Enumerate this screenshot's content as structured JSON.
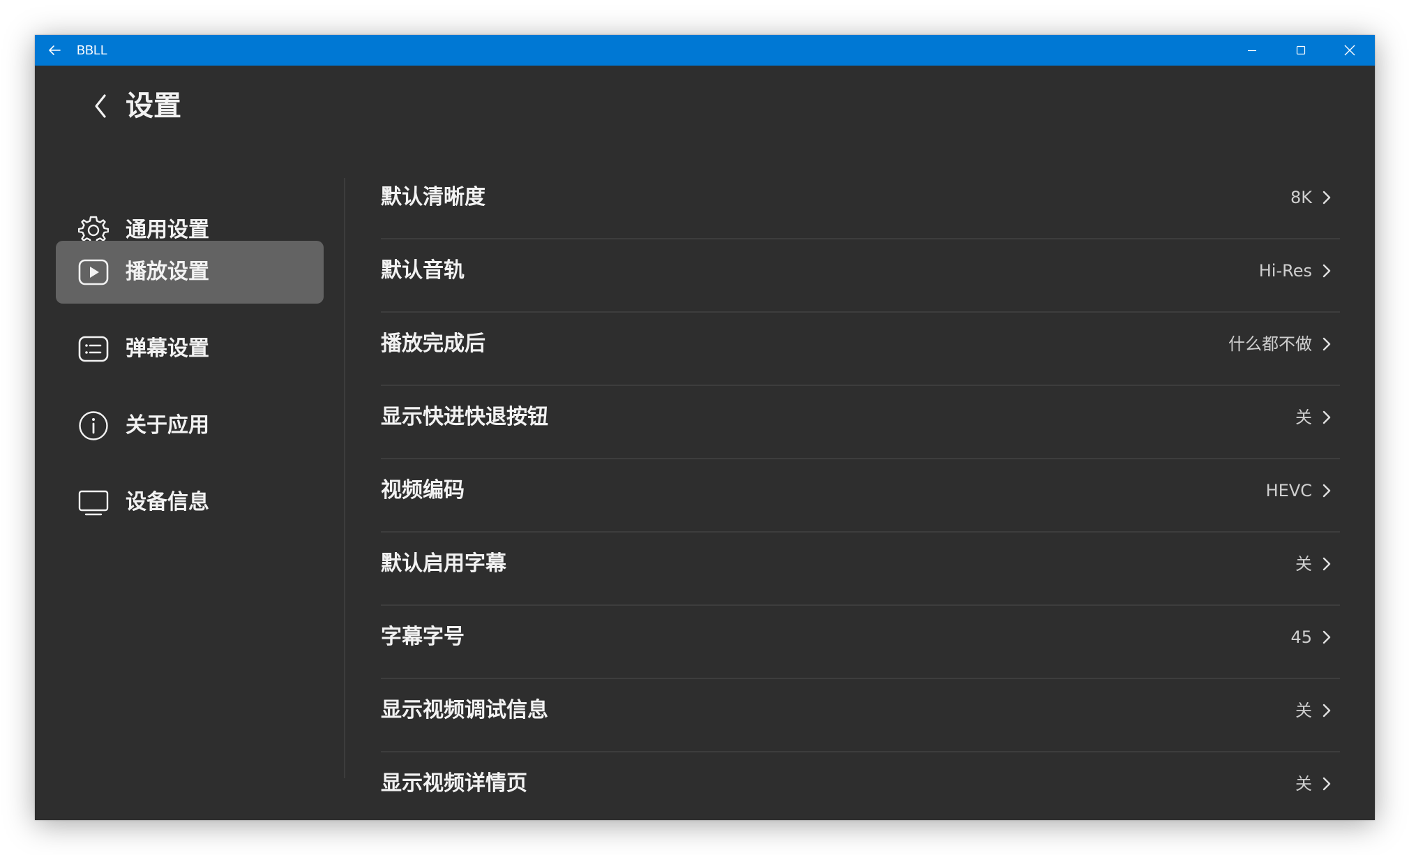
{
  "titlebar": {
    "app_name": "BBLL"
  },
  "page": {
    "title": "设置"
  },
  "sidebar": {
    "items": [
      {
        "label": "通用设置",
        "icon": "gear-icon"
      },
      {
        "label": "播放设置",
        "icon": "play-icon",
        "selected": true
      },
      {
        "label": "弹幕设置",
        "icon": "danmaku-icon"
      },
      {
        "label": "关于应用",
        "icon": "info-icon"
      },
      {
        "label": "设备信息",
        "icon": "monitor-icon"
      }
    ]
  },
  "settings": {
    "rows": [
      {
        "label": "默认清晰度",
        "value": "8K"
      },
      {
        "label": "默认音轨",
        "value": "Hi-Res"
      },
      {
        "label": "播放完成后",
        "value": "什么都不做"
      },
      {
        "label": "显示快进快退按钮",
        "value": "关"
      },
      {
        "label": "视频编码",
        "value": "HEVC"
      },
      {
        "label": "默认启用字幕",
        "value": "关"
      },
      {
        "label": "字幕字号",
        "value": "45"
      },
      {
        "label": "显示视频调试信息",
        "value": "关"
      },
      {
        "label": "显示视频详情页",
        "value": "关"
      }
    ]
  },
  "colors": {
    "titlebar": "#0078d4",
    "background": "#2e2e2e",
    "selected_item": "#636363"
  }
}
